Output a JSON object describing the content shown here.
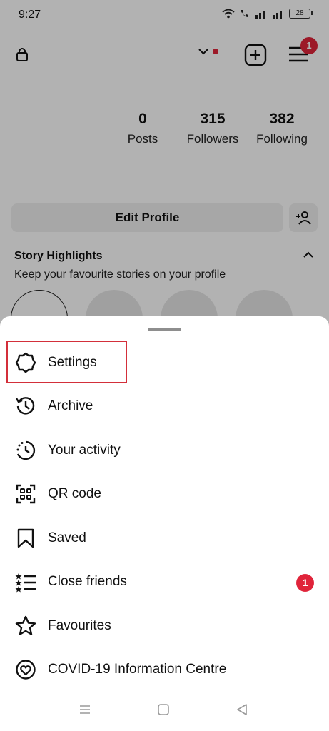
{
  "status": {
    "time": "9:27",
    "battery": "28"
  },
  "header": {
    "notification_count": "1"
  },
  "profile": {
    "stats": [
      {
        "value": "0",
        "label": "Posts"
      },
      {
        "value": "315",
        "label": "Followers"
      },
      {
        "value": "382",
        "label": "Following"
      }
    ],
    "edit_label": "Edit Profile"
  },
  "highlights": {
    "title": "Story Highlights",
    "subtitle": "Keep your favourite stories on your profile"
  },
  "menu": {
    "items": [
      {
        "label": "Settings",
        "icon": "settings-icon"
      },
      {
        "label": "Archive",
        "icon": "archive-icon"
      },
      {
        "label": "Your activity",
        "icon": "activity-icon"
      },
      {
        "label": "QR code",
        "icon": "qr-code-icon"
      },
      {
        "label": "Saved",
        "icon": "bookmark-icon"
      },
      {
        "label": "Close friends",
        "icon": "close-friends-icon",
        "badge": "1"
      },
      {
        "label": "Favourites",
        "icon": "star-icon"
      },
      {
        "label": "COVID-19 Information Centre",
        "icon": "covid-info-icon"
      }
    ]
  },
  "colors": {
    "accent_red": "#e0243a",
    "highlight_box": "#d32f3a"
  }
}
